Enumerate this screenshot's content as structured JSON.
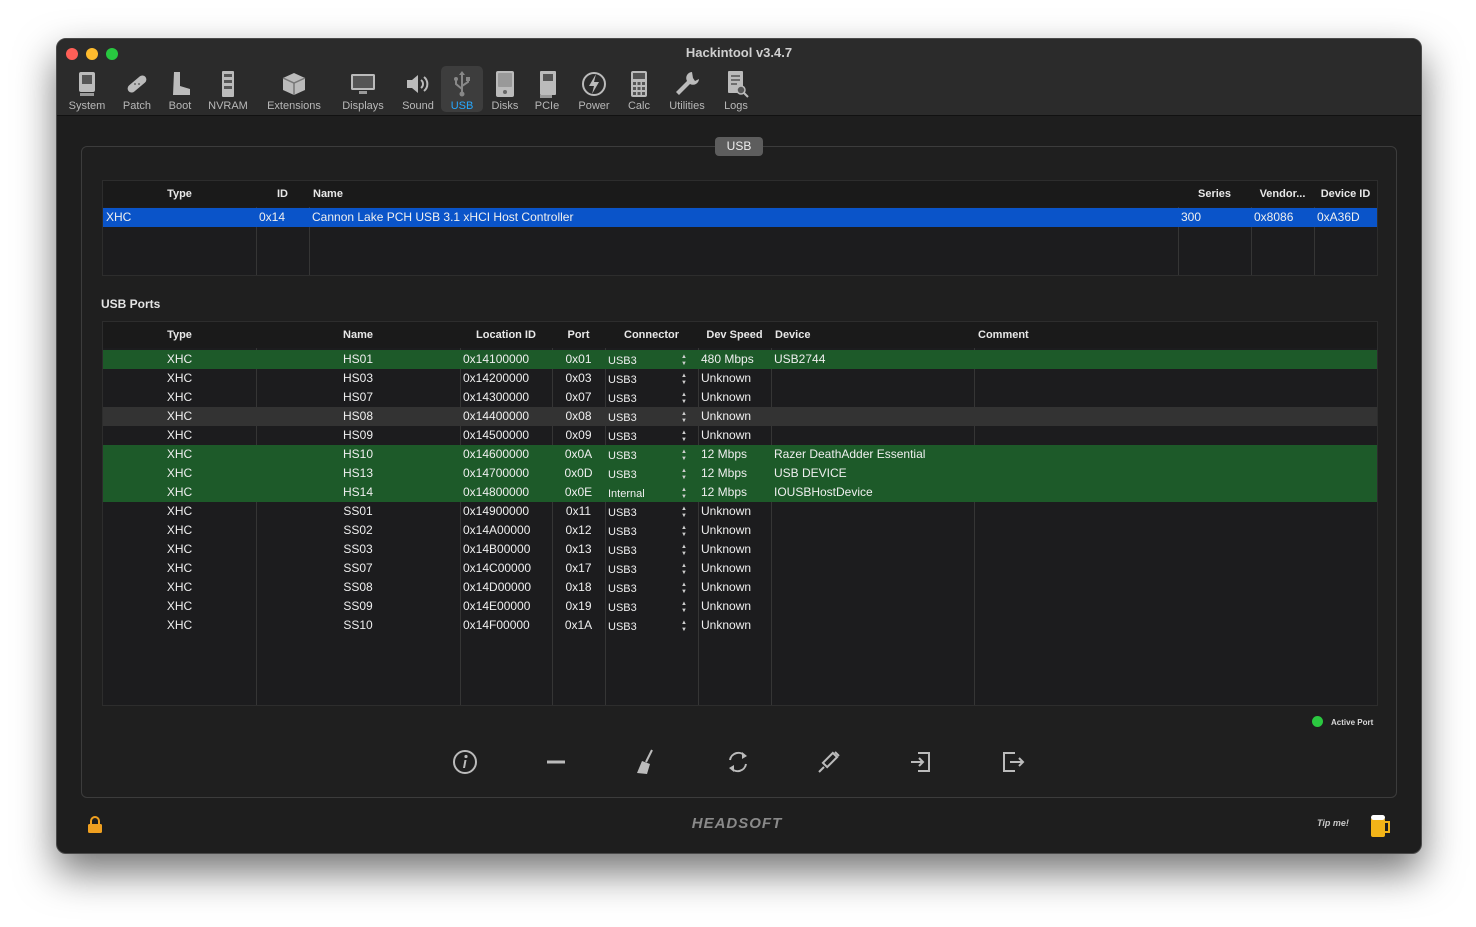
{
  "window": {
    "title": "Hackintool v3.4.7"
  },
  "toolbar": [
    {
      "label": "System",
      "icon": "system-icon"
    },
    {
      "label": "Patch",
      "icon": "patch-icon"
    },
    {
      "label": "Boot",
      "icon": "boot-icon"
    },
    {
      "label": "NVRAM",
      "icon": "nvram-icon"
    },
    {
      "label": "Extensions",
      "icon": "extensions-icon"
    },
    {
      "label": "Displays",
      "icon": "displays-icon"
    },
    {
      "label": "Sound",
      "icon": "sound-icon"
    },
    {
      "label": "USB",
      "icon": "usb-icon",
      "selected": true
    },
    {
      "label": "Disks",
      "icon": "disks-icon"
    },
    {
      "label": "PCIe",
      "icon": "pcie-icon"
    },
    {
      "label": "Power",
      "icon": "power-icon"
    },
    {
      "label": "Calc",
      "icon": "calc-icon"
    },
    {
      "label": "Utilities",
      "icon": "utilities-icon"
    },
    {
      "label": "Logs",
      "icon": "logs-icon"
    }
  ],
  "panel_tab": "USB",
  "controllers": {
    "headers": [
      "Type",
      "ID",
      "Name",
      "Series",
      "Vendor...",
      "Device ID"
    ],
    "rows": [
      {
        "type": "XHC",
        "id": "0x14",
        "name": "Cannon Lake PCH USB 3.1 xHCI Host Controller",
        "series": "300",
        "vendor": "0x8086",
        "device_id": "0xA36D",
        "selected": true
      }
    ]
  },
  "ports_title": "USB Ports",
  "ports": {
    "headers": [
      "Type",
      "Name",
      "Location ID",
      "Port",
      "Connector",
      "Dev Speed",
      "Device",
      "Comment"
    ],
    "rows": [
      {
        "type": "XHC",
        "name": "HS01",
        "location": "0x14100000",
        "port": "0x01",
        "connector": "USB3",
        "speed": "480 Mbps",
        "device": "USB2744",
        "comment": "",
        "state": "active"
      },
      {
        "type": "XHC",
        "name": "HS03",
        "location": "0x14200000",
        "port": "0x03",
        "connector": "USB3",
        "speed": "Unknown",
        "device": "",
        "comment": "",
        "state": ""
      },
      {
        "type": "XHC",
        "name": "HS07",
        "location": "0x14300000",
        "port": "0x07",
        "connector": "USB3",
        "speed": "Unknown",
        "device": "",
        "comment": "",
        "state": ""
      },
      {
        "type": "XHC",
        "name": "HS08",
        "location": "0x14400000",
        "port": "0x08",
        "connector": "USB3",
        "speed": "Unknown",
        "device": "",
        "comment": "",
        "state": "gray"
      },
      {
        "type": "XHC",
        "name": "HS09",
        "location": "0x14500000",
        "port": "0x09",
        "connector": "USB3",
        "speed": "Unknown",
        "device": "",
        "comment": "",
        "state": ""
      },
      {
        "type": "XHC",
        "name": "HS10",
        "location": "0x14600000",
        "port": "0x0A",
        "connector": "USB3",
        "speed": "12 Mbps",
        "device": "Razer DeathAdder Essential",
        "comment": "",
        "state": "active"
      },
      {
        "type": "XHC",
        "name": "HS13",
        "location": "0x14700000",
        "port": "0x0D",
        "connector": "USB3",
        "speed": "12 Mbps",
        "device": "USB DEVICE",
        "comment": "",
        "state": "active"
      },
      {
        "type": "XHC",
        "name": "HS14",
        "location": "0x14800000",
        "port": "0x0E",
        "connector": "Internal",
        "speed": "12 Mbps",
        "device": "IOUSBHostDevice",
        "comment": "",
        "state": "active"
      },
      {
        "type": "XHC",
        "name": "SS01",
        "location": "0x14900000",
        "port": "0x11",
        "connector": "USB3",
        "speed": "Unknown",
        "device": "",
        "comment": "",
        "state": ""
      },
      {
        "type": "XHC",
        "name": "SS02",
        "location": "0x14A00000",
        "port": "0x12",
        "connector": "USB3",
        "speed": "Unknown",
        "device": "",
        "comment": "",
        "state": ""
      },
      {
        "type": "XHC",
        "name": "SS03",
        "location": "0x14B00000",
        "port": "0x13",
        "connector": "USB3",
        "speed": "Unknown",
        "device": "",
        "comment": "",
        "state": ""
      },
      {
        "type": "XHC",
        "name": "SS07",
        "location": "0x14C00000",
        "port": "0x17",
        "connector": "USB3",
        "speed": "Unknown",
        "device": "",
        "comment": "",
        "state": ""
      },
      {
        "type": "XHC",
        "name": "SS08",
        "location": "0x14D00000",
        "port": "0x18",
        "connector": "USB3",
        "speed": "Unknown",
        "device": "",
        "comment": "",
        "state": ""
      },
      {
        "type": "XHC",
        "name": "SS09",
        "location": "0x14E00000",
        "port": "0x19",
        "connector": "USB3",
        "speed": "Unknown",
        "device": "",
        "comment": "",
        "state": ""
      },
      {
        "type": "XHC",
        "name": "SS10",
        "location": "0x14F00000",
        "port": "0x1A",
        "connector": "USB3",
        "speed": "Unknown",
        "device": "",
        "comment": "",
        "state": ""
      }
    ]
  },
  "legend": {
    "label": "Active Port",
    "color": "#2bc840"
  },
  "actions": [
    "info-icon",
    "remove-icon",
    "clear-icon",
    "refresh-icon",
    "inject-icon",
    "import-icon",
    "export-icon"
  ],
  "footer": {
    "logo": "HEADSOFT",
    "tip": "Tip me!"
  },
  "colors": {
    "selected_row": "#0a54c9",
    "active_row": "#1d5a29",
    "accent": "#27a8ff"
  }
}
